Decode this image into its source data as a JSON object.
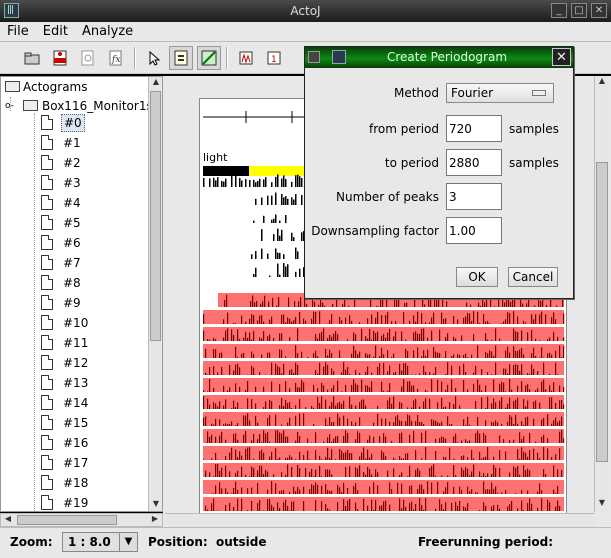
{
  "window": {
    "title": "ActoJ"
  },
  "menubar": {
    "items": [
      "File",
      "Edit",
      "Analyze"
    ]
  },
  "tree": {
    "root": "Actograms",
    "monitor": "Box116_Monitor1s",
    "items": [
      "#0",
      "#1",
      "#2",
      "#3",
      "#4",
      "#5",
      "#6",
      "#7",
      "#8",
      "#9",
      "#10",
      "#11",
      "#12",
      "#13",
      "#14",
      "#15",
      "#16",
      "#17",
      "#18",
      "#19"
    ],
    "selected_index": 0
  },
  "actogram": {
    "light_label": "light"
  },
  "status": {
    "zoom_label": "Zoom:",
    "zoom_value": "1 : 8.0",
    "position_label": "Position:",
    "position_value": "outside",
    "freerunning_label": "Freerunning period:"
  },
  "dialog": {
    "title": "Create Periodogram",
    "method_label": "Method",
    "method_value": "Fourier",
    "from_label": "from period",
    "from_value": "720",
    "from_unit": "samples",
    "to_label": "to period",
    "to_value": "2880",
    "to_unit": "samples",
    "peaks_label": "Number of peaks",
    "peaks_value": "3",
    "downsampling_label": "Downsampling factor",
    "downsampling_value": "1.00",
    "ok_label": "OK",
    "cancel_label": "Cancel"
  },
  "colors": {
    "selection_red": "#ff7070",
    "activity_dark_red": "#7a0000",
    "light_yellow": "#ffff00",
    "dialog_title_green": "#0b8a13"
  },
  "toolbar": {
    "icons": [
      "open-folder-icon",
      "pdf-export-icon",
      "magnifier-icon",
      "function-icon",
      "pointer-icon",
      "document-select-icon",
      "chart-select-icon",
      "periodogram-icon",
      "calendar-icon"
    ]
  }
}
